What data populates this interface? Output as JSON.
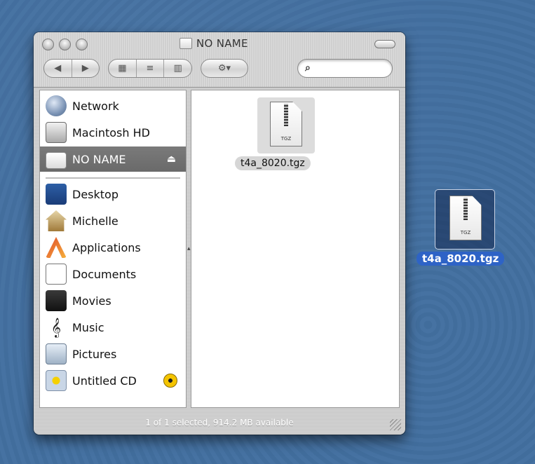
{
  "window": {
    "title": "NO NAME",
    "status_text": "1 of 1 selected, 914.2 MB available"
  },
  "toolbar": {
    "nav_back": "◀",
    "nav_forward": "▶",
    "view_icons": "▦",
    "view_list": "≡",
    "view_columns": "▥",
    "action_label": "⚙▾",
    "search_placeholder": ""
  },
  "sidebar": {
    "devices": [
      {
        "label": "Network",
        "icon": "network-icon"
      },
      {
        "label": "Macintosh HD",
        "icon": "hard-drive-icon"
      },
      {
        "label": "NO NAME",
        "icon": "drive-icon",
        "selected": true,
        "eject": "⏏"
      }
    ],
    "places": [
      {
        "label": "Desktop",
        "icon": "desktop-icon"
      },
      {
        "label": "Michelle",
        "icon": "home-icon"
      },
      {
        "label": "Applications",
        "icon": "applications-icon"
      },
      {
        "label": "Documents",
        "icon": "documents-icon"
      },
      {
        "label": "Movies",
        "icon": "movies-icon"
      },
      {
        "label": "Music",
        "icon": "music-icon"
      },
      {
        "label": "Pictures",
        "icon": "pictures-icon"
      },
      {
        "label": "Untitled CD",
        "icon": "cd-icon"
      }
    ]
  },
  "content": {
    "file": {
      "name": "t4a_8020.tgz",
      "type_label": "TGZ"
    }
  },
  "desktop": {
    "file": {
      "name": "t4a_8020.tgz",
      "type_label": "TGZ"
    }
  },
  "colors": {
    "selection": "#2e63c6",
    "sidebar_selected": "#6e6e6e"
  }
}
